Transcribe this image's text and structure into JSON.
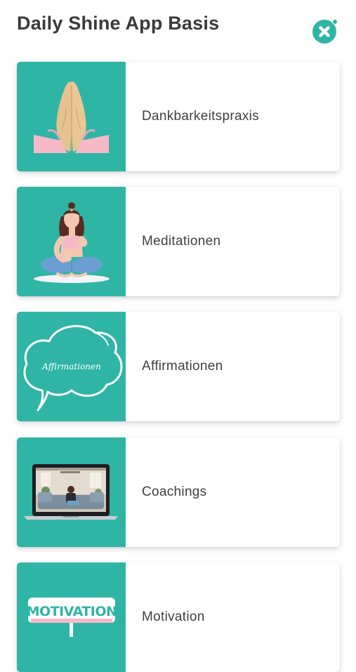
{
  "header": {
    "title": "Daily Shine App Basis",
    "close_icon": "close-icon"
  },
  "colors": {
    "accent": "#2fb5a6",
    "title_text": "#3a3a3a",
    "card_background": "#ffffff"
  },
  "items": [
    {
      "label": "Dankbarkeitspraxis",
      "icon": "praying-hands-icon"
    },
    {
      "label": "Meditationen",
      "icon": "meditating-woman-icon"
    },
    {
      "label": "Affirmationen",
      "icon": "speech-cloud-icon",
      "image_text": "Affirmationen"
    },
    {
      "label": "Coachings",
      "icon": "laptop-video-icon"
    },
    {
      "label": "Motivation",
      "icon": "motivation-sign-icon",
      "image_text": "MOTIVATION"
    }
  ]
}
